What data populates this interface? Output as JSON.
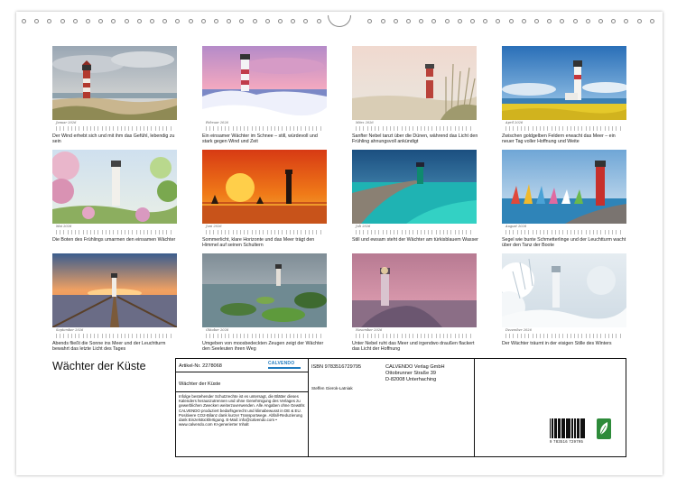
{
  "tiles": [
    {
      "month": "Januar 2026",
      "caption": "Der Wind erhebt sich und mit ihm das Gefühl, lebendig zu sein"
    },
    {
      "month": "Februar 2026",
      "caption": "Ein einsamer Wächter im Schnee – still, würdevoll und stark gegen Wind und Zeit"
    },
    {
      "month": "März 2026",
      "caption": "Sanfter Nebel tanzt über die Dünen, während das Licht den Frühling ahnungsvoll ankündigt"
    },
    {
      "month": "April 2026",
      "caption": "Zwischen goldgelben Feldern erwacht das Meer – ein neuer Tag voller Hoffnung und Weite"
    },
    {
      "month": "Mai 2026",
      "caption": "Die Boten des Frühlings umarmen den einsamen Wächter"
    },
    {
      "month": "Juni 2026",
      "caption": "Sommerlicht, klare Horizonte und das Meer trägt den Himmel auf seinen Schultern"
    },
    {
      "month": "Juli 2026",
      "caption": "Still und ewsam steht der Wächter am türkisblauem Wasser"
    },
    {
      "month": "August 2026",
      "caption": "Segel wie bunte Schmetterlinge und der Leuchtturm wacht über den Tanz der Boote"
    },
    {
      "month": "September 2026",
      "caption": "Abends fließt die Sonne ins Meer und der Leuchtturm bewahrt das letzte Licht des Tages"
    },
    {
      "month": "Oktober 2026",
      "caption": "Umgeben von moosbedeckten Zeugen zeigt der Wächter den Seeleuten ihren Weg"
    },
    {
      "month": "November 2026",
      "caption": "Unter Nebel ruht das Meer und irgendwo draußen flackert das Licht der Hoffnung"
    },
    {
      "month": "Dezember 2026",
      "caption": "Der Wächter träumt in der eisigen Stille des Winters"
    }
  ],
  "title": "Wächter der Küste",
  "info": {
    "article": "Artikel-Nr. 2278068",
    "product_title": "Wächter der Küste",
    "logo": "CALVENDO",
    "legal": "Infolge bestehender Schutzrechte ist es untersagt, die Blätter dieses Kalenders herauszutrennen und ohne Genehmigung des Verlages zu gewerblichen Zwecken weiterzuverwenden. Alle Angaben ohne Gewähr. CALVENDO produziert bedarfsgerecht und klimabewusst in DE & EU. Positivere CO2-Bilanz dank kurzer Transportwege. Abfall-Reduzierung dank Einzelstückfertigung. E-Mail: info@calvendo.com • www.calvendo.com KI-generierter Inhalt",
    "isbn": "ISBN 9783516729795",
    "author": "Steffen Gierok-Latniak",
    "publisher_name": "CALVENDO Verlag GmbH",
    "publisher_street": "Ottobrunner Straße 39",
    "publisher_city": "D-82008 Unterhaching",
    "barcode_number": "9 783516 729795"
  },
  "colors": {
    "frame": "#111111",
    "logo_blue": "#1f7bbf",
    "eco_green": "#2e8b3a"
  }
}
